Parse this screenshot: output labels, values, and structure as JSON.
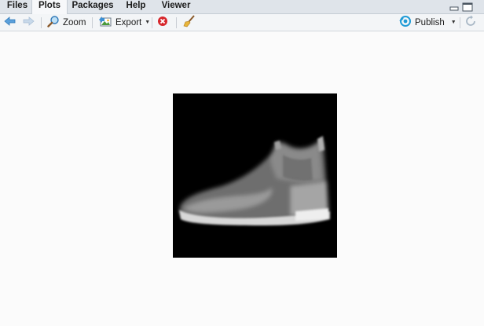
{
  "tabs": [
    {
      "label": "Files",
      "active": false
    },
    {
      "label": "Plots",
      "active": true
    },
    {
      "label": "Packages",
      "active": false
    },
    {
      "label": "Help",
      "active": false
    },
    {
      "label": "Viewer",
      "active": false
    }
  ],
  "toolbar": {
    "zoom_label": "Zoom",
    "export_label": "Export",
    "publish_label": "Publish"
  },
  "icons": {
    "back": "arrow-left-icon",
    "forward": "arrow-right-icon",
    "zoom": "magnifier-icon",
    "export": "export-image-icon",
    "remove": "remove-plot-icon",
    "clear": "broom-icon",
    "publish": "publish-icon",
    "refresh": "refresh-icon",
    "minimize": "minimize-icon",
    "maximize": "maximize-icon"
  },
  "colors": {
    "tab_bar": "#dfe4ea",
    "toolbar": "#f3f5f7",
    "accent_blue": "#3b8fd3",
    "remove_red": "#d7262b",
    "plot_background": "#000000"
  },
  "plot": {
    "description_name": "grayscale-ankle-boot-image"
  }
}
